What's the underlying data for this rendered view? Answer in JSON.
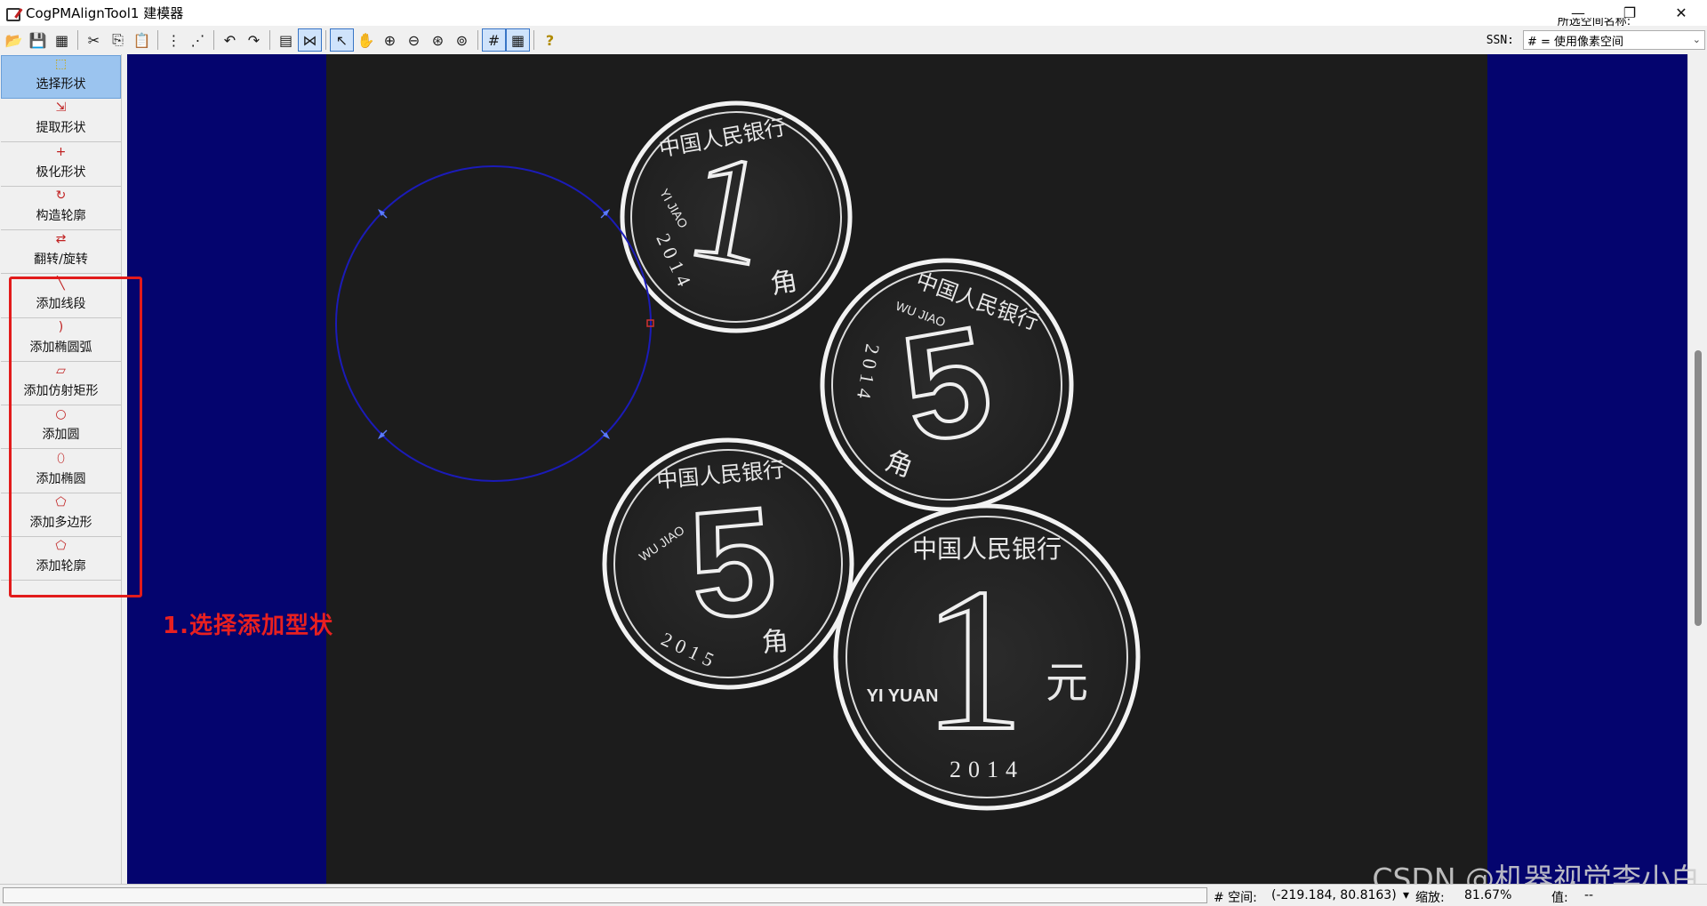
{
  "window": {
    "title": "CogPMAlignTool1 建模器",
    "minimize": "—",
    "restore": "❐",
    "close": "✕"
  },
  "toolbar": {
    "buttons": [
      {
        "name": "open-icon",
        "glyph": "📂"
      },
      {
        "name": "save-icon",
        "glyph": "💾"
      },
      {
        "name": "save-all-icon",
        "glyph": "▦"
      },
      {
        "name": "cut-icon",
        "glyph": "✂"
      },
      {
        "name": "copy-icon",
        "glyph": "⎘"
      },
      {
        "name": "paste-icon",
        "glyph": "📋"
      },
      {
        "name": "select-all-icon",
        "glyph": "⋮"
      },
      {
        "name": "deselect-icon",
        "glyph": "⋰"
      },
      {
        "name": "undo-icon",
        "glyph": "↶"
      },
      {
        "name": "redo-icon",
        "glyph": "↷"
      },
      {
        "name": "properties-icon",
        "glyph": "▤"
      },
      {
        "name": "fit-toggle-icon",
        "glyph": "⋈"
      },
      {
        "name": "pointer-icon",
        "glyph": "↖"
      },
      {
        "name": "pan-hand-icon",
        "glyph": "✋"
      },
      {
        "name": "zoom-in-icon",
        "glyph": "⊕"
      },
      {
        "name": "zoom-out-icon",
        "glyph": "⊖"
      },
      {
        "name": "zoom-fit-icon",
        "glyph": "⊛"
      },
      {
        "name": "zoom-actual-icon",
        "glyph": "⊚"
      },
      {
        "name": "grid-icon",
        "glyph": "#"
      },
      {
        "name": "pixel-grid-icon",
        "glyph": "▦"
      },
      {
        "name": "help-icon",
        "glyph": "?"
      }
    ],
    "overflow_label": "所选空间名称:",
    "ssn_label": "SSN:",
    "ssn_value": "# = 使用像素空间",
    "ssn_chevron": "⌄"
  },
  "left_tools": [
    {
      "label": "选择形状",
      "icon": "⬚",
      "selected": true
    },
    {
      "label": "提取形状",
      "icon": "⇲",
      "selected": false
    },
    {
      "label": "极化形状",
      "icon": "+",
      "selected": false
    },
    {
      "label": "构造轮廓",
      "icon": "↻",
      "selected": false
    },
    {
      "label": "翻转/旋转",
      "icon": "⇄",
      "selected": false
    },
    {
      "label": "添加线段",
      "icon": "╲",
      "selected": false
    },
    {
      "label": "添加椭圆弧",
      "icon": ")",
      "selected": false
    },
    {
      "label": "添加仿射矩形",
      "icon": "▱",
      "selected": false
    },
    {
      "label": "添加圆",
      "icon": "○",
      "selected": false
    },
    {
      "label": "添加椭圆",
      "icon": "⬯",
      "selected": false
    },
    {
      "label": "添加多边形",
      "icon": "⬠",
      "selected": false
    },
    {
      "label": "添加轮廓",
      "icon": "⬠",
      "selected": false
    }
  ],
  "annotation": {
    "text": "1.选择添加型状"
  },
  "coins": [
    {
      "face": "1",
      "top_text": "中国人民银行",
      "lower_text": "YI JIAO",
      "year": "2014",
      "unit": "角"
    },
    {
      "face": "5",
      "top_text": "中国人民银行",
      "lower_text": "WU JIAO",
      "year": "2014",
      "unit": "角"
    },
    {
      "face": "5",
      "top_text": "中国人民银行",
      "lower_text": "WU JIAO",
      "year": "2015",
      "unit": "角"
    },
    {
      "face": "1",
      "top_text": "中国人民银行",
      "lower_text": "YI YUAN",
      "year": "2014",
      "unit": "元"
    }
  ],
  "status": {
    "space_label": "# 空间:",
    "coords": "(-219.184, 80.8163)",
    "zoom_label": "缩放:",
    "zoom_value": "81.67%",
    "value_label": "值:",
    "value": "--"
  },
  "watermark": "CSDN @机器视觉李小白",
  "colors": {
    "canvas_bg": "#04046e",
    "circle_stroke": "#1b1bb8",
    "handle": "#5b7cff",
    "annotation_red": "#e21b1b"
  }
}
